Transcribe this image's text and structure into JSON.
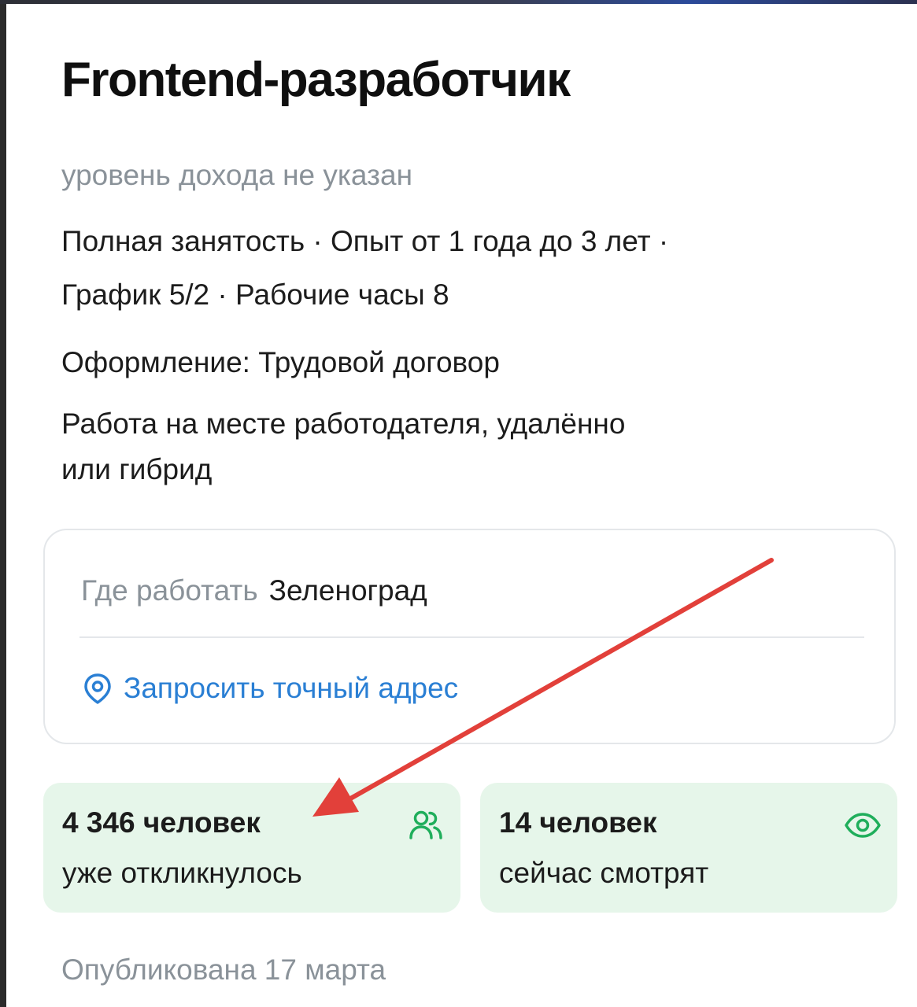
{
  "vacancy": {
    "title": "Frontend-разработчик",
    "salary": "уровень дохода не указан",
    "conditions_line1": "Полная занятость · Опыт от 1 года до 3 лет ·",
    "conditions_line2": "График 5/2 · Рабочие часы 8",
    "employment": "Оформление: Трудовой договор",
    "work_format_line1": "Работа на месте работодателя, удалённо",
    "work_format_line2": "или гибрид"
  },
  "location": {
    "label": "Где работать",
    "city": "Зеленоград",
    "address_link": "Запросить точный адрес",
    "link_icon": "location-pin-icon"
  },
  "stats": {
    "responses_count": "4 346 человек",
    "responses_text": "уже откликнулось",
    "responses_icon": "people-icon",
    "viewers_count": "14 человек",
    "viewers_text": "сейчас смотрят",
    "viewers_icon": "eye-icon"
  },
  "published": "Опубликована 17 марта",
  "colors": {
    "link": "#2a7fd4",
    "muted": "#8a9299",
    "stat_bg": "#e6f6ea",
    "stat_icon": "#1fae5b",
    "annotation_arrow": "#e2403a"
  }
}
